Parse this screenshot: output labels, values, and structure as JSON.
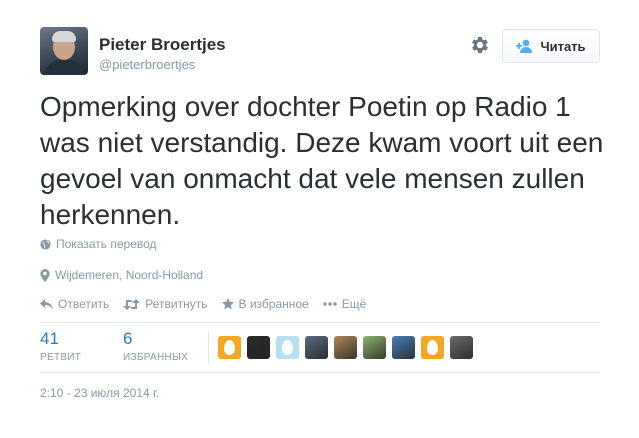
{
  "author": {
    "fullname": "Pieter Broertjes",
    "username": "@pieterbroertjes"
  },
  "follow_button": {
    "label": "Читать",
    "icon": "add-user-icon"
  },
  "settings_icon": "gear-icon",
  "tweet": {
    "text": "Opmerking over dochter Poetin op Radio 1 was niet verstandig. Deze kwam voort uit een gevoel van onmacht dat vele mensen zullen herkennen."
  },
  "translate": {
    "label": "Показать перевод",
    "icon": "globe-icon"
  },
  "location": {
    "label": "Wijdemeren, Noord-Holland",
    "icon": "map-pin-icon"
  },
  "actions": {
    "reply": "Ответить",
    "retweet": "Ретвитнуть",
    "favorite": "В избранное",
    "more": "Ещё"
  },
  "stats": {
    "retweets": {
      "count": "41",
      "label": "РЕТВИТ"
    },
    "favorites": {
      "count": "6",
      "label": "ИЗБРАННЫХ"
    }
  },
  "faces": [
    {
      "kind": "egg",
      "color": "#f5a623"
    },
    {
      "kind": "photo",
      "color": "#2b2b2b"
    },
    {
      "kind": "egg",
      "color": "#b6dff0"
    },
    {
      "kind": "photo",
      "color": "#5a6a7e"
    },
    {
      "kind": "photo",
      "color": "#b08a5a"
    },
    {
      "kind": "photo",
      "color": "#8fb36a"
    },
    {
      "kind": "photo",
      "color": "#4a7fb5"
    },
    {
      "kind": "egg",
      "color": "#f5a623"
    },
    {
      "kind": "photo",
      "color": "#6b6b6b"
    }
  ],
  "timestamp": "2:10 - 23 июля 2014 г.",
  "colors": {
    "link": "#2b7bb9",
    "muted": "#8899a6",
    "text": "#292f33",
    "border": "#e1e8ed"
  }
}
